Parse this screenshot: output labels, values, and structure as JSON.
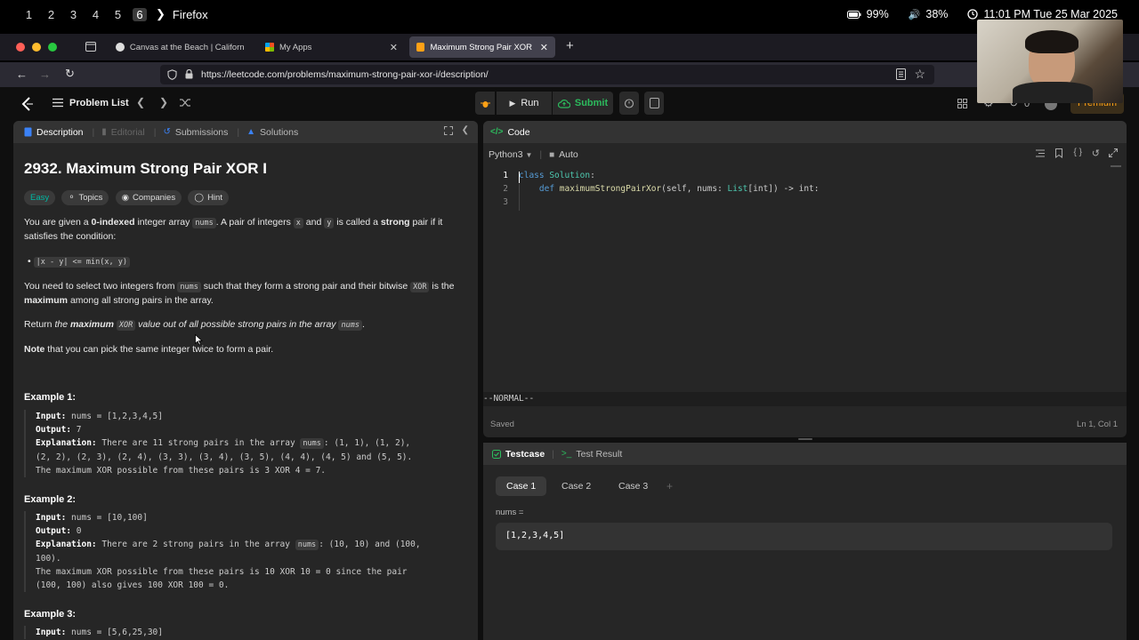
{
  "os": {
    "workspaces": [
      "1",
      "2",
      "3",
      "4",
      "5",
      "6"
    ],
    "app_name": "Firefox",
    "battery": "99%",
    "volume": "38%",
    "clock": "11:01 PM  Tue 25 Mar 2025"
  },
  "browser": {
    "tabs": [
      {
        "title": "Canvas at the Beach | California"
      },
      {
        "title": "My Apps"
      },
      {
        "title": "Maximum Strong Pair XOR I - Le"
      }
    ],
    "url": "https://leetcode.com/problems/maximum-strong-pair-xor-i/description/"
  },
  "lc_nav": {
    "problem_list": "Problem List",
    "run": "Run",
    "submit": "Submit",
    "count": "0",
    "premium": "Premium"
  },
  "left_tabs": {
    "description": "Description",
    "editorial": "Editorial",
    "submissions": "Submissions",
    "solutions": "Solutions"
  },
  "problem": {
    "title": "2932. Maximum Strong Pair XOR I",
    "difficulty": "Easy",
    "topics": "Topics",
    "companies": "Companies",
    "hint": "Hint",
    "p1": {
      "a": "You are given a ",
      "b": "0-indexed",
      "c": " integer array ",
      "d": "nums",
      "e": ". A pair of integers ",
      "f": "x",
      "g": " and ",
      "h": "y",
      "i": " is called a ",
      "j": "strong",
      "k": " pair if it satisfies the condition:"
    },
    "condition": "|x - y| <= min(x, y)",
    "p2": {
      "a": "You need to select two integers from ",
      "b": "nums",
      "c": " such that they form a strong pair and their bitwise ",
      "d": "XOR",
      "e": " is the ",
      "f": "maximum",
      "g": " among all strong pairs in the array."
    },
    "p3": {
      "a": "Return ",
      "b": "the ",
      "c": "maximum",
      "d": "XOR",
      "e": " value out of all possible strong pairs in the array ",
      "f": "nums",
      "g": "."
    },
    "p4": {
      "a": "Note",
      "b": " that you can pick the same integer twice to form a pair."
    },
    "ex1": {
      "heading": "Example 1:",
      "input_label": "Input:",
      "input": " nums = [1,2,3,4,5]",
      "output_label": "Output:",
      "output": " 7",
      "expl_label": "Explanation:",
      "expl_a": " There are 11 strong pairs in the array ",
      "expl_b": "nums",
      "expl_c": ": (1, 1), (1, 2),",
      "line2": "(2, 2), (2, 3), (2, 4), (3, 3), (3, 4), (3, 5), (4, 4), (4, 5) and (5, 5).",
      "line3": "The maximum XOR possible from these pairs is 3 XOR 4 = 7."
    },
    "ex2": {
      "heading": "Example 2:",
      "input_label": "Input:",
      "input": " nums = [10,100]",
      "output_label": "Output:",
      "output": " 0",
      "expl_label": "Explanation:",
      "expl_a": " There are 2 strong pairs in the array ",
      "expl_b": "nums",
      "expl_c": ": (10, 10) and (100,",
      "line2": "100).",
      "line3": "The maximum XOR possible from these pairs is 10 XOR 10 = 0 since the pair",
      "line4": "(100, 100) also gives 100 XOR 100 = 0."
    },
    "ex3": {
      "heading": "Example 3:",
      "input_label": "Input:",
      "input": " nums = [5,6,25,30]"
    }
  },
  "code_panel": {
    "title": "Code",
    "language": "Python3",
    "mode": "Auto",
    "lines": [
      {
        "num": "1",
        "a": "class ",
        "b": "Solution",
        "c": ":"
      },
      {
        "num": "2",
        "a": "    def ",
        "b": "maximumStrongPairXor",
        "c": "(self, nums: ",
        "d": "List",
        "e": "[int]) -> int:"
      },
      {
        "num": "3"
      }
    ],
    "vim_mode": "--NORMAL--",
    "saved": "Saved",
    "cursor_pos": "Ln 1, Col 1"
  },
  "test_panel": {
    "testcase_tab": "Testcase",
    "result_tab": "Test Result",
    "cases": [
      "Case 1",
      "Case 2",
      "Case 3"
    ],
    "add": "+",
    "var_label": "nums =",
    "var_value": "[1,2,3,4,5]"
  },
  "colors": {
    "easy": "#00b8a3",
    "submit_green": "#2cbb5d",
    "premium": "#ffa116",
    "accent_orange": "#ffa116"
  }
}
